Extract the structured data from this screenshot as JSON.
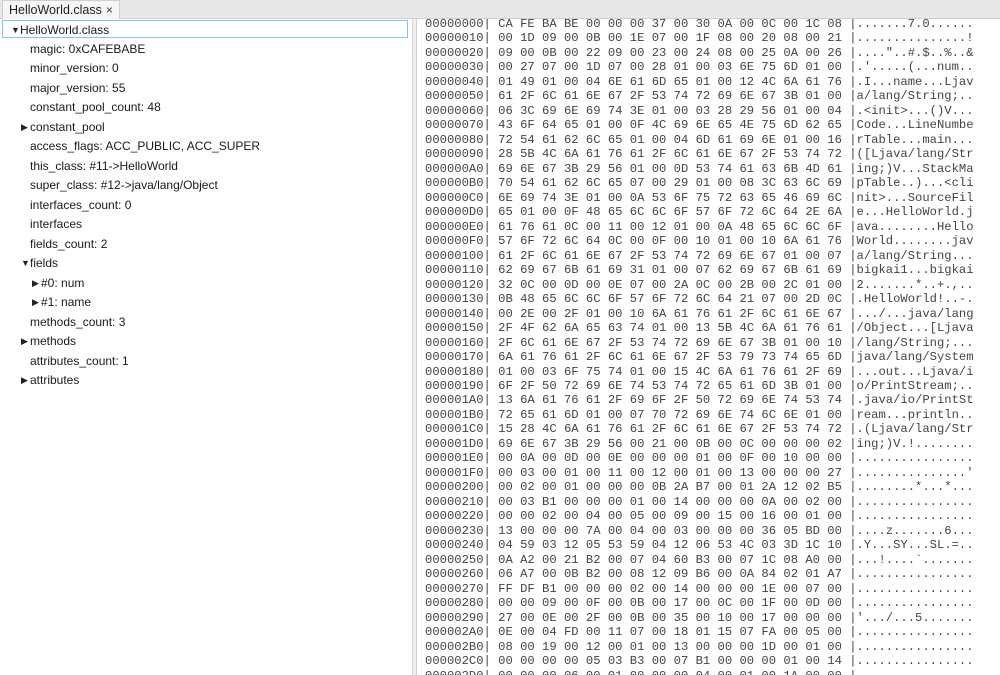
{
  "tab": {
    "title": "HelloWorld.class",
    "close_icon": "×"
  },
  "tree": [
    {
      "level": 0,
      "label": "HelloWorld.class",
      "expander": "expanded",
      "selected": true
    },
    {
      "level": 1,
      "label": "magic: 0xCAFEBABE",
      "expander": "none"
    },
    {
      "level": 1,
      "label": "minor_version: 0",
      "expander": "none"
    },
    {
      "level": 1,
      "label": "major_version: 55",
      "expander": "none"
    },
    {
      "level": 1,
      "label": "constant_pool_count: 48",
      "expander": "none"
    },
    {
      "level": 1,
      "label": "constant_pool",
      "expander": "collapsed"
    },
    {
      "level": 1,
      "label": "access_flags: ACC_PUBLIC, ACC_SUPER",
      "expander": "none"
    },
    {
      "level": 1,
      "label": "this_class: #11->HelloWorld",
      "expander": "none"
    },
    {
      "level": 1,
      "label": "super_class: #12->java/lang/Object",
      "expander": "none"
    },
    {
      "level": 1,
      "label": "interfaces_count: 0",
      "expander": "none"
    },
    {
      "level": 1,
      "label": "interfaces",
      "expander": "none"
    },
    {
      "level": 1,
      "label": "fields_count: 2",
      "expander": "none"
    },
    {
      "level": 1,
      "label": "fields",
      "expander": "expanded"
    },
    {
      "level": 2,
      "label": "#0: num",
      "expander": "collapsed"
    },
    {
      "level": 2,
      "label": "#1: name",
      "expander": "collapsed"
    },
    {
      "level": 1,
      "label": "methods_count: 3",
      "expander": "none"
    },
    {
      "level": 1,
      "label": "methods",
      "expander": "collapsed"
    },
    {
      "level": 1,
      "label": "attributes_count: 1",
      "expander": "none"
    },
    {
      "level": 1,
      "label": "attributes",
      "expander": "collapsed"
    }
  ],
  "hex_rows": [
    [
      "00000000",
      "CA FE BA BE 00 00 00 37 00 30 0A 00 0C 00 1C 08",
      ".......7.0......"
    ],
    [
      "00000010",
      "00 1D 09 00 0B 00 1E 07 00 1F 08 00 20 08 00 21",
      "...............!"
    ],
    [
      "00000020",
      "09 00 0B 00 22 09 00 23 00 24 08 00 25 0A 00 26",
      "....\"..#.$..%..&"
    ],
    [
      "00000030",
      "00 27 07 00 1D 07 00 28 01 00 03 6E 75 6D 01 00",
      ".'.....(...num.."
    ],
    [
      "00000040",
      "01 49 01 00 04 6E 61 6D 65 01 00 12 4C 6A 61 76",
      ".I...name...Ljav"
    ],
    [
      "00000050",
      "61 2F 6C 61 6E 67 2F 53 74 72 69 6E 67 3B 01 00",
      "a/lang/String;.."
    ],
    [
      "00000060",
      "06 3C 69 6E 69 74 3E 01 00 03 28 29 56 01 00 04",
      ".<init>...()V..."
    ],
    [
      "00000070",
      "43 6F 64 65 01 00 0F 4C 69 6E 65 4E 75 6D 62 65",
      "Code...LineNumbe"
    ],
    [
      "00000080",
      "72 54 61 62 6C 65 01 00 04 6D 61 69 6E 01 00 16",
      "rTable...main..."
    ],
    [
      "00000090",
      "28 5B 4C 6A 61 76 61 2F 6C 61 6E 67 2F 53 74 72",
      "([Ljava/lang/Str"
    ],
    [
      "000000A0",
      "69 6E 67 3B 29 56 01 00 0D 53 74 61 63 6B 4D 61",
      "ing;)V...StackMa"
    ],
    [
      "000000B0",
      "70 54 61 62 6C 65 07 00 29 01 00 08 3C 63 6C 69",
      "pTable..)...<cli"
    ],
    [
      "000000C0",
      "6E 69 74 3E 01 00 0A 53 6F 75 72 63 65 46 69 6C",
      "nit>...SourceFil"
    ],
    [
      "000000D0",
      "65 01 00 0F 48 65 6C 6C 6F 57 6F 72 6C 64 2E 6A",
      "e...HelloWorld.j"
    ],
    [
      "000000E0",
      "61 76 61 0C 00 11 00 12 01 00 0A 48 65 6C 6C 6F",
      "ava........Hello"
    ],
    [
      "000000F0",
      "57 6F 72 6C 64 0C 00 0F 00 10 01 00 10 6A 61 76",
      "World........jav"
    ],
    [
      "00000100",
      "61 2F 6C 61 6E 67 2F 53 74 72 69 6E 67 01 00 07",
      "a/lang/String..."
    ],
    [
      "00000110",
      "62 69 67 6B 61 69 31 01 00 07 62 69 67 6B 61 69",
      "bigkai1...bigkai"
    ],
    [
      "00000120",
      "32 0C 00 0D 00 0E 07 00 2A 0C 00 2B 00 2C 01 00",
      "2.......*..+.,.."
    ],
    [
      "00000130",
      "0B 48 65 6C 6C 6F 57 6F 72 6C 64 21 07 00 2D 0C",
      ".HelloWorld!..-."
    ],
    [
      "00000140",
      "00 2E 00 2F 01 00 10 6A 61 76 61 2F 6C 61 6E 67",
      ".../...java/lang"
    ],
    [
      "00000150",
      "2F 4F 62 6A 65 63 74 01 00 13 5B 4C 6A 61 76 61",
      "/Object...[Ljava"
    ],
    [
      "00000160",
      "2F 6C 61 6E 67 2F 53 74 72 69 6E 67 3B 01 00 10",
      "/lang/String;..."
    ],
    [
      "00000170",
      "6A 61 76 61 2F 6C 61 6E 67 2F 53 79 73 74 65 6D",
      "java/lang/System"
    ],
    [
      "00000180",
      "01 00 03 6F 75 74 01 00 15 4C 6A 61 76 61 2F 69",
      "...out...Ljava/i"
    ],
    [
      "00000190",
      "6F 2F 50 72 69 6E 74 53 74 72 65 61 6D 3B 01 00",
      "o/PrintStream;.."
    ],
    [
      "000001A0",
      "13 6A 61 76 61 2F 69 6F 2F 50 72 69 6E 74 53 74",
      ".java/io/PrintSt"
    ],
    [
      "000001B0",
      "72 65 61 6D 01 00 07 70 72 69 6E 74 6C 6E 01 00",
      "ream...println.."
    ],
    [
      "000001C0",
      "15 28 4C 6A 61 76 61 2F 6C 61 6E 67 2F 53 74 72",
      ".(Ljava/lang/Str"
    ],
    [
      "000001D0",
      "69 6E 67 3B 29 56 00 21 00 0B 00 0C 00 00 00 02",
      "ing;)V.!........"
    ],
    [
      "000001E0",
      "00 0A 00 0D 00 0E 00 00 00 01 00 0F 00 10 00 00",
      "................"
    ],
    [
      "000001F0",
      "00 03 00 01 00 11 00 12 00 01 00 13 00 00 00 27",
      "...............'"
    ],
    [
      "00000200",
      "00 02 00 01 00 00 00 0B 2A B7 00 01 2A 12 02 B5",
      "........*...*..."
    ],
    [
      "00000210",
      "00 03 B1 00 00 00 01 00 14 00 00 00 0A 00 02 00",
      "................"
    ],
    [
      "00000220",
      "00 00 02 00 04 00 05 00 09 00 15 00 16 00 01 00",
      "................"
    ],
    [
      "00000230",
      "13 00 00 00 7A 00 04 00 03 00 00 00 36 05 BD 00",
      "....z.......6..."
    ],
    [
      "00000240",
      "04 59 03 12 05 53 59 04 12 06 53 4C 03 3D 1C 10",
      ".Y...SY...SL.=.."
    ],
    [
      "00000250",
      "0A A2 00 21 B2 00 07 04 60 B3 00 07 1C 08 A0 00",
      "...!....`......."
    ],
    [
      "00000260",
      "06 A7 00 0B B2 00 08 12 09 B6 00 0A 84 02 01 A7",
      "................"
    ],
    [
      "00000270",
      "FF DF B1 00 00 00 02 00 14 00 00 00 1E 00 07 00",
      "................"
    ],
    [
      "00000280",
      "00 00 09 00 0F 00 0B 00 17 00 0C 00 1F 00 0D 00",
      "................"
    ],
    [
      "00000290",
      "27 00 0E 00 2F 00 0B 00 35 00 10 00 17 00 00 00",
      "'.../...5......."
    ],
    [
      "000002A0",
      "0E 00 04 FD 00 11 07 00 18 01 15 07 FA 00 05 00",
      "................"
    ],
    [
      "000002B0",
      "08 00 19 00 12 00 01 00 13 00 00 00 1D 00 01 00",
      "................"
    ],
    [
      "000002C0",
      "00 00 00 00 05 03 B3 00 07 B1 00 00 00 01 00 14",
      "................"
    ],
    [
      "000002D0",
      "00 00 00 06 00 01 00 00 00 04 00 01 00 1A 00 00",
      "................"
    ]
  ]
}
